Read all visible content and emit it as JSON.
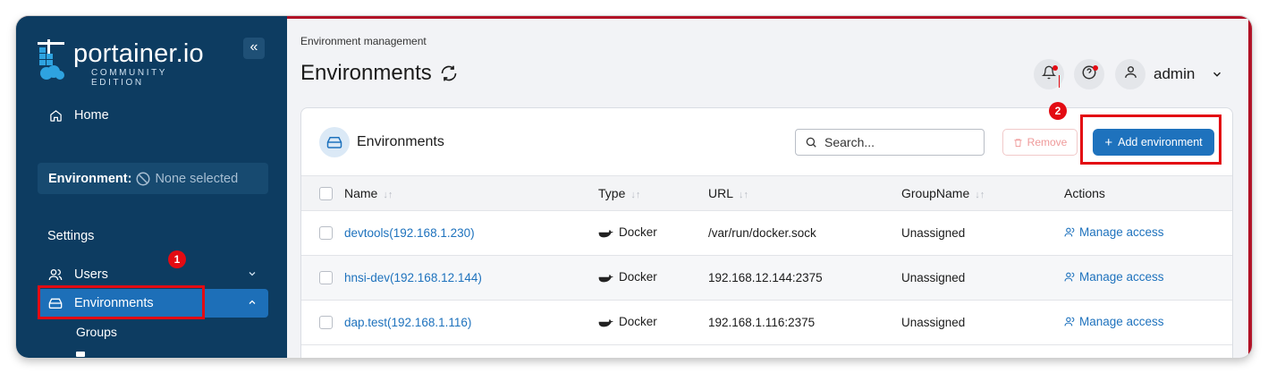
{
  "sidebar": {
    "logo_text": "portainer.io",
    "logo_sub": "COMMUNITY EDITION",
    "home_label": "Home",
    "environment_label": "Environment:",
    "environment_value": "None selected",
    "settings_label": "Settings",
    "users_label": "Users",
    "environments_label": "Environments",
    "groups_label": "Groups"
  },
  "annotations": {
    "badge1": "1",
    "badge2": "2"
  },
  "header": {
    "breadcrumb": "Environment management",
    "title": "Environments",
    "user": "admin"
  },
  "panel": {
    "title": "Environments",
    "search_placeholder": "Search...",
    "remove_label": "Remove",
    "add_label": "Add environment"
  },
  "table": {
    "columns": [
      "Name",
      "Type",
      "URL",
      "GroupName",
      "Actions"
    ],
    "rows": [
      {
        "name": "devtools(192.168.1.230)",
        "type": "Docker",
        "url": "/var/run/docker.sock",
        "group": "Unassigned",
        "action": "Manage access"
      },
      {
        "name": "hnsi-dev(192.168.12.144)",
        "type": "Docker",
        "url": "192.168.12.144:2375",
        "group": "Unassigned",
        "action": "Manage access"
      },
      {
        "name": "dap.test(192.168.1.116)",
        "type": "Docker",
        "url": "192.168.1.116:2375",
        "group": "Unassigned",
        "action": "Manage access"
      }
    ]
  },
  "colors": {
    "sidebar": "#0d3c61",
    "active": "#1d6fb8",
    "accent": "#1e72bd",
    "highlight": "#e30b13"
  }
}
